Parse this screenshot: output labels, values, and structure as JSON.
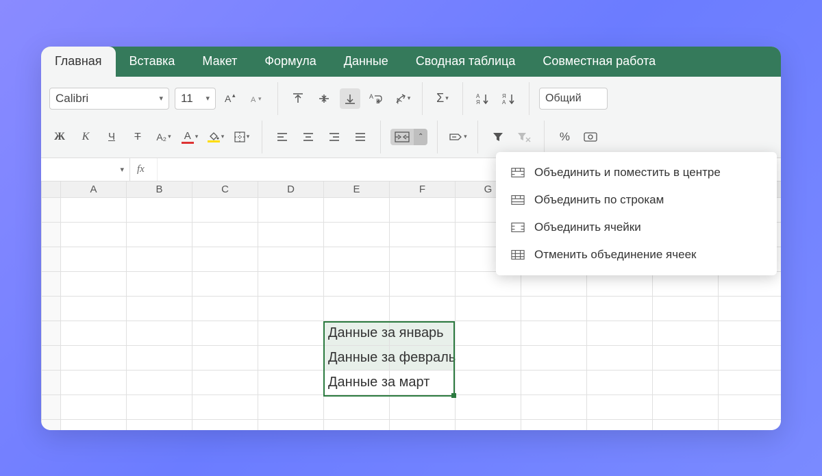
{
  "tabs": [
    "Главная",
    "Вставка",
    "Макет",
    "Формула",
    "Данные",
    "Сводная таблица",
    "Совместная работа"
  ],
  "activeTab": 0,
  "toolbar": {
    "font": "Calibri",
    "size": "11",
    "bold": "Ж",
    "italic": "К",
    "underline": "Ч",
    "strike": "Т",
    "subscript": "A₂",
    "numberFormat": "Общий",
    "percent": "%"
  },
  "formula": {
    "fx": "fx"
  },
  "columns": [
    "A",
    "B",
    "C",
    "D",
    "E",
    "F",
    "G"
  ],
  "cells": {
    "E6": "Данные за январь",
    "E7": "Данные за февраль",
    "E8": "Данные за март"
  },
  "mergeMenu": {
    "items": [
      "Объединить и поместить в центре",
      "Объединить по строкам",
      "Объединить ячейки",
      "Отменить объединение ячеек"
    ]
  }
}
